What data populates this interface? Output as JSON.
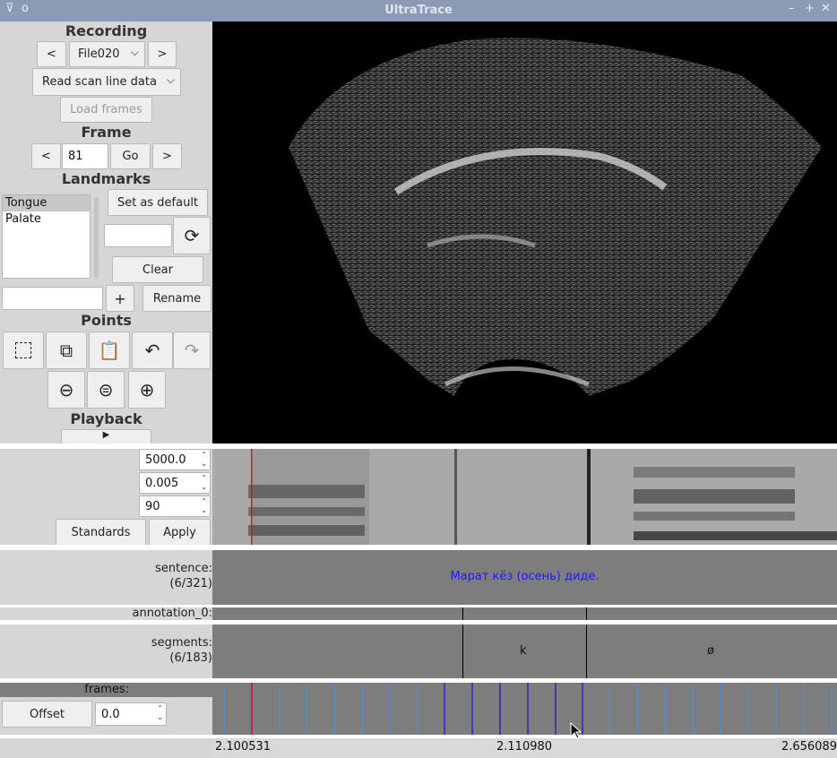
{
  "window": {
    "title": "UltraTrace",
    "controls": {
      "minimize": "–",
      "maximize": "+",
      "close": "✕",
      "menu": "⊽",
      "pin": "o"
    }
  },
  "recording": {
    "heading": "Recording",
    "prev": "<",
    "next": ">",
    "file": "File020",
    "read_option": "Read scan line data",
    "load_frames": "Load frames"
  },
  "frame": {
    "heading": "Frame",
    "prev": "<",
    "value": "81",
    "go": "Go",
    "next": ">"
  },
  "landmarks": {
    "heading": "Landmarks",
    "items": [
      {
        "label": "Tongue",
        "selected": true
      },
      {
        "label": "Palate",
        "selected": false
      }
    ],
    "set_default": "Set as default",
    "clear": "Clear",
    "add": "+",
    "rename": "Rename"
  },
  "points": {
    "heading": "Points",
    "icons": [
      "select-icon",
      "copy-icon",
      "paste-icon",
      "undo-icon",
      "redo-icon",
      "zoom-out-icon",
      "zoom-reset-icon",
      "zoom-in-icon"
    ]
  },
  "playback": {
    "heading": "Playback"
  },
  "spectrogram": {
    "max_freq": "5000.0",
    "window_len": "0.005",
    "dyn_range": "90",
    "standards": "Standards",
    "apply": "Apply"
  },
  "tiers": {
    "sentence_label": "sentence:",
    "sentence_count": "(6/321)",
    "sentence_text": "Марат кёз (осень) диде.",
    "annotation_label": "annotation_0:",
    "segments_label": "segments:",
    "segments_count": "(6/183)",
    "segment_k": "k",
    "segment_o": "ø",
    "frames_label": "frames:",
    "offset_button": "Offset",
    "offset_value": "0.0"
  },
  "timeline": {
    "start": "2.100531",
    "middle": "2.110980",
    "end": "2.656089"
  },
  "colors": {
    "titlebar": "#8b9bb5",
    "tier_bg": "#7d7d7d",
    "sentence_text": "#1a1aff",
    "cursor_red": "#e8002a",
    "frame_line_light": "#4a8fe0",
    "frame_line_dark": "#1010c8"
  }
}
